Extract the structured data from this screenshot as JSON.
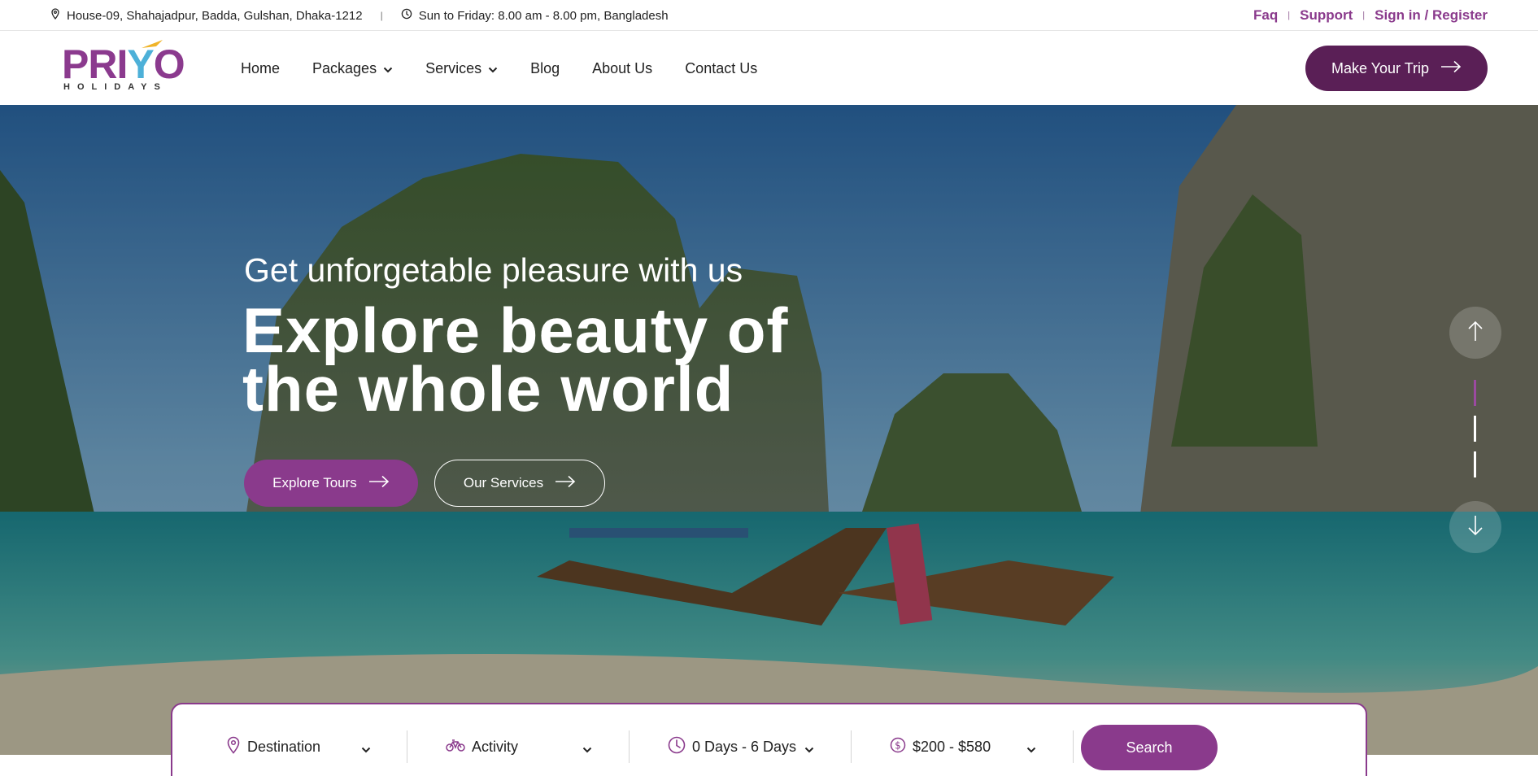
{
  "topbar": {
    "address": "House-09, Shahajadpur, Badda, Gulshan, Dhaka-1212",
    "hours": "Sun to Friday: 8.00 am - 8.00 pm, Bangladesh",
    "links": [
      "Faq",
      "Support",
      "Sign in / Register"
    ]
  },
  "header": {
    "logo_word": "PRIYO",
    "logo_sub": "HOLIDAYS",
    "nav": [
      {
        "label": "Home",
        "dropdown": false
      },
      {
        "label": "Packages",
        "dropdown": true
      },
      {
        "label": "Services",
        "dropdown": true
      },
      {
        "label": "Blog",
        "dropdown": false
      },
      {
        "label": "About Us",
        "dropdown": false
      },
      {
        "label": "Contact Us",
        "dropdown": false
      }
    ],
    "cta_label": "Make Your Trip"
  },
  "hero": {
    "kicker": "Get unforgetable pleasure with us",
    "title": "Explore beauty of the whole world",
    "primary_button": "Explore Tours",
    "secondary_button": "Our Services",
    "slides_total": 3,
    "active_slide": 1
  },
  "search": {
    "destination": "Destination",
    "activity": "Activity",
    "duration": "0 Days - 6 Days",
    "price": "$200 - $580",
    "button": "Search"
  },
  "colors": {
    "brand": "#8a3a8c",
    "brand_dark": "#5a1f56",
    "logo_accent": "#4db0d8"
  }
}
